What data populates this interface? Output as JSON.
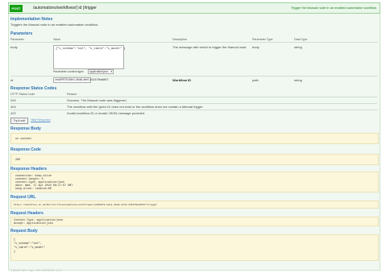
{
  "endpoint": {
    "method": "POST",
    "path": "/automations/workflows/{ id }/trigger",
    "summary": "Trigger the Manual node in an enabled automation workflow"
  },
  "implementation_notes": {
    "heading": "Implementation Notes",
    "text": "Triggers the Manual node in an enabled automation workflow."
  },
  "parameters": {
    "heading": "Parameters",
    "columns": [
      "Parameter",
      "Value",
      "Description",
      "Parameter Type",
      "Data Type"
    ],
    "rows": [
      {
        "name": "body",
        "value": "{\"s_schema\":\"xml\", \"s_table\":\"s_model\" }",
        "description": "The message with which to trigger the Manual node",
        "param_type": "body",
        "data_type": "string",
        "content_type_label": "Parameter content type:",
        "content_type_value": "application/json"
      },
      {
        "name": "id",
        "value": "cea59978-b8e1-4ba6-afe0-431479ba6f07",
        "description": "Workflow ID",
        "param_type": "path",
        "data_type": "string"
      }
    ]
  },
  "response_messages": {
    "heading": "Response Status Codes",
    "columns": [
      "HTTP Status Code",
      "Reason"
    ],
    "rows": [
      {
        "code": "200",
        "reason": "Success. The Manual node was triggered."
      },
      {
        "code": "404",
        "reason": "The workflow with the given ID does not exist or the workflow does not contain a Manual trigger."
      },
      {
        "code": "422",
        "reason": "Invalid workflow ID or invalid JSON message provided."
      }
    ]
  },
  "actions": {
    "try_label": "Try it out!",
    "hide_label": "Hide Response"
  },
  "response_body": {
    "heading": "Response Body",
    "text": "no content"
  },
  "response_code": {
    "heading": "Response Code",
    "text": "200"
  },
  "response_headers": {
    "heading": "Response Headers",
    "lines": [
      "connection: keep-alive",
      "content-length: 0",
      "content-type: application/json",
      "date: Wed, 17 Apr 2024 08:17:57 GMT",
      "keep-alive: timeout=60"
    ]
  },
  "request_url": {
    "heading": "Request URL",
    "text": "https://datafloo.in.de/Mernst/l3/automations/workflows/cea59978-b8e1-4ba6-afe0-431479ba6f07/trigger"
  },
  "request_headers": {
    "heading": "Request Headers",
    "lines": [
      "Content-Type: application/json",
      "Accept: application/json"
    ]
  },
  "request_body": {
    "heading": "Request Body",
    "lines": [
      "{",
      "  \"s_schema\":\"xml\",",
      "  \"s_table\":\"s_model\"",
      "}"
    ]
  },
  "footer": {
    "text": "[ BASE URL: /api , API VERSION: 1.0 ]"
  },
  "colors": {
    "accent_green": "#12a012",
    "heading_blue": "#2a6db0",
    "panel_bg": "#f1f8f1",
    "code_bg": "#fcf6db"
  }
}
